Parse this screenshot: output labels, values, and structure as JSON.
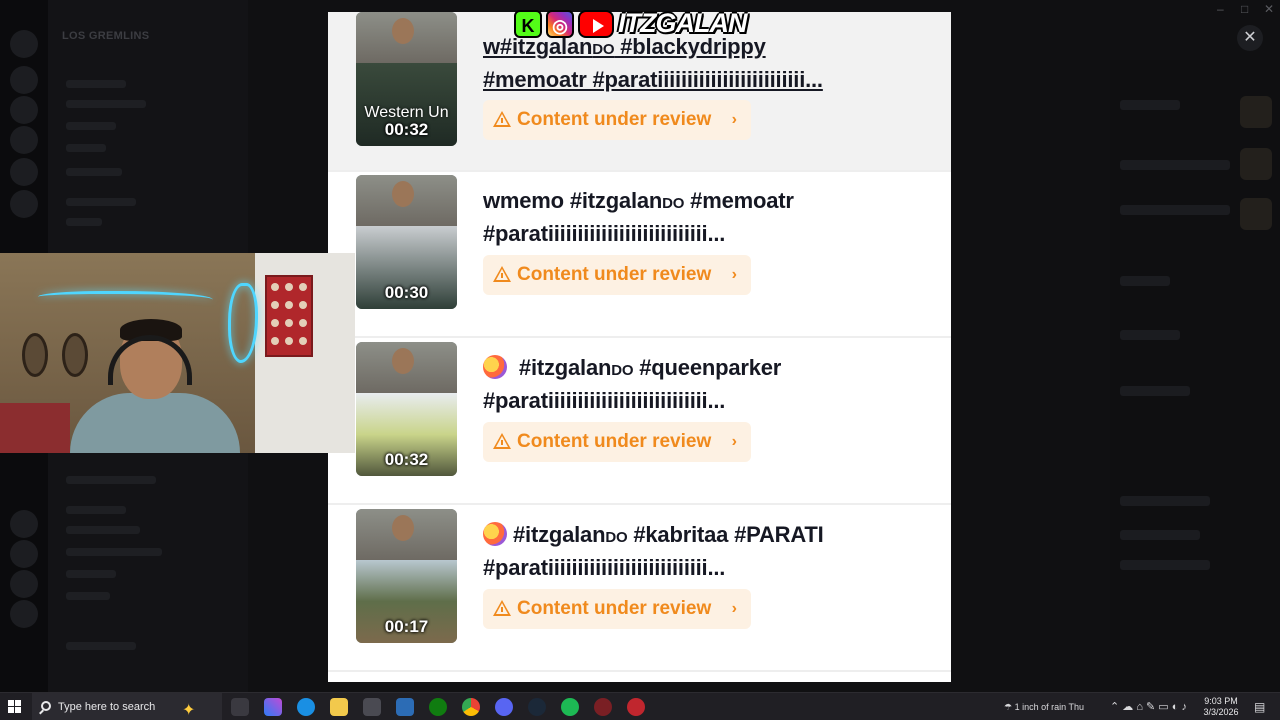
{
  "background": {
    "server_name": "LOS GREMLINS"
  },
  "overlay": {
    "channel_name": "ITZGALAN",
    "icons": [
      "kick-icon",
      "instagram-icon",
      "youtube-icon"
    ]
  },
  "feed": {
    "items": [
      {
        "title_line1_prefix": "w#itzgalan",
        "title_line1_small": "DO",
        "title_line1_suffix": " #blackydrippy",
        "title_line2": "#memoatr #paratiiiiiiiiiiiiiiiiiiiiiiiii...",
        "review_label": "Content under review",
        "duration": "00:32",
        "thumb_caption": "Western Un"
      },
      {
        "title_line1_prefix": "wmemo #itzgalan",
        "title_line1_small": "DO",
        "title_line1_suffix": " #memoatr",
        "title_line2": "#paratiiiiiiiiiiiiiiiiiiiiiiiiiii...",
        "review_label": "Content under review",
        "duration": "00:30"
      },
      {
        "title_line1_prefix": " #itzgalan",
        "title_line1_small": "DO",
        "title_line1_suffix": " #queenparker",
        "title_line2": "#paratiiiiiiiiiiiiiiiiiiiiiiiiiii...",
        "review_label": "Content under review",
        "duration": "00:32"
      },
      {
        "title_line1_prefix": "#itzgalan",
        "title_line1_small": "DO",
        "title_line1_suffix": " #kabritaa #PARATI",
        "title_line2": "#paratiiiiiiiiiiiiiiiiiiiiiiiiiii...",
        "review_label": "Content under review",
        "duration": "00:17"
      }
    ]
  },
  "colors": {
    "review_bg": "#fdf1e3",
    "review_text": "#f08a1d",
    "title_text": "#161823"
  },
  "taskbar": {
    "search_placeholder": "Type here to search",
    "weather": "1 inch of rain Thu",
    "time": "9:03 PM",
    "date": "3/3/2026"
  }
}
